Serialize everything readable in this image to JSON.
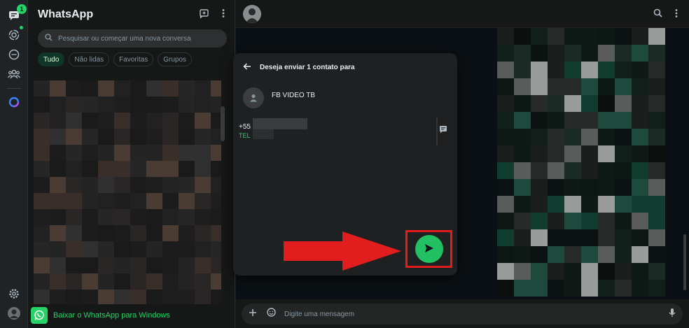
{
  "sidebar": {
    "unread_badge": "1",
    "icons": [
      "chats-icon",
      "status-icon",
      "channels-icon",
      "communities-icon",
      "meta-ai-icon",
      "settings-icon",
      "profile-avatar"
    ]
  },
  "chat_list": {
    "title": "WhatsApp",
    "search_placeholder": "Pesquisar ou começar uma nova conversa",
    "filters": [
      {
        "label": "Tudo",
        "active": true
      },
      {
        "label": "Não lidas",
        "active": false
      },
      {
        "label": "Favoritas",
        "active": false
      },
      {
        "label": "Grupos",
        "active": false
      }
    ],
    "download_banner": "Baixar o WhatsApp para Windows"
  },
  "dialog": {
    "title": "Deseja enviar 1 contato para",
    "contact_name": "FB VIDEO TB",
    "phone_prefix": "+55",
    "phone_type": "TEL"
  },
  "composer": {
    "placeholder": "Digite uma mensagem"
  },
  "colors": {
    "accent": "#25d366",
    "send_button": "#21c063",
    "highlight": "#e11d1d"
  }
}
